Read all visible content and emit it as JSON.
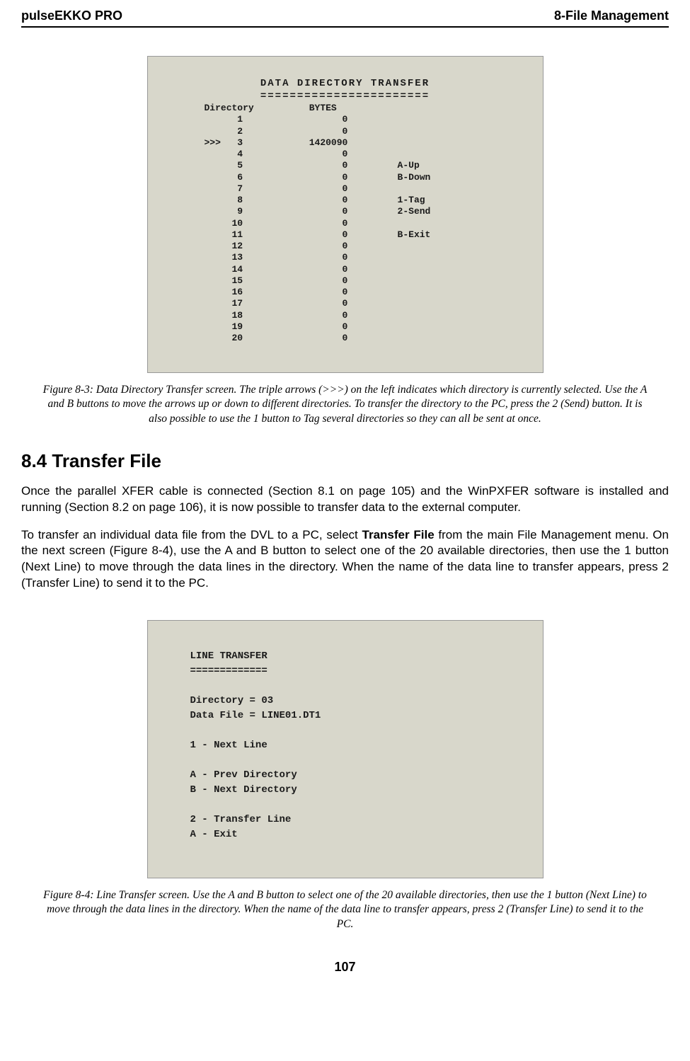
{
  "header": {
    "left": "pulseEKKO PRO",
    "right": "8-File Management"
  },
  "figure1": {
    "title": "DATA  DIRECTORY  TRANSFER",
    "underline": "=======================",
    "col_headers": "Directory          BYTES",
    "rows": [
      "      1                  0",
      "      2                  0",
      ">>>   3            1420090",
      "      4                  0",
      "      5                  0         A-Up",
      "      6                  0         B-Down",
      "      7                  0",
      "      8                  0         1-Tag",
      "      9                  0         2-Send",
      "     10                  0",
      "     11                  0         B-Exit",
      "     12                  0",
      "     13                  0",
      "     14                  0",
      "     15                  0",
      "     16                  0",
      "     17                  0",
      "     18                  0",
      "     19                  0",
      "     20                  0"
    ],
    "caption": "Figure 8-3:  Data Directory Transfer screen. The triple arrows (>>>) on the left indicates which directory is currently selected. Use the A and B buttons to move the arrows up or down to different directories. To transfer the directory to the PC, press the 2 (Send) button. It is also possible to use the 1 button to Tag several directories so they can all be sent at once."
  },
  "section": {
    "heading": "8.4    Transfer File",
    "para1_a": "Once the parallel XFER cable is connected (Section 8.1 on page 105) and the WinPXFER software is installed and running (Section 8.2 on page 106), it is now possible to transfer data to the external computer.",
    "para2_a": "To transfer an individual data file from the DVL to a PC, select ",
    "para2_bold": "Transfer File",
    "para2_b": " from the main File Management menu. On the next screen (Figure 8-4), use the A and B button to select one of the 20 available directories, then use the 1 button (Next Line) to move through the data lines in the directory. When the name of the data line to transfer appears, press 2 (Transfer Line) to send it to the PC."
  },
  "figure2": {
    "title": "LINE TRANSFER",
    "underline": "=============",
    "lines": [
      "Directory  =   03",
      "Data File  =   LINE01.DT1",
      "",
      "1 - Next Line",
      "",
      "A - Prev Directory",
      "B - Next Directory",
      "",
      "2 - Transfer Line",
      "A - Exit"
    ],
    "caption": "Figure 8-4:  Line Transfer screen. Use the A and B button to select one of the 20 available directories, then use the 1 button (Next Line) to move through the data lines in the directory. When the name of the data line to transfer appears, press 2 (Transfer Line) to send it to the PC."
  },
  "page_number": "107"
}
